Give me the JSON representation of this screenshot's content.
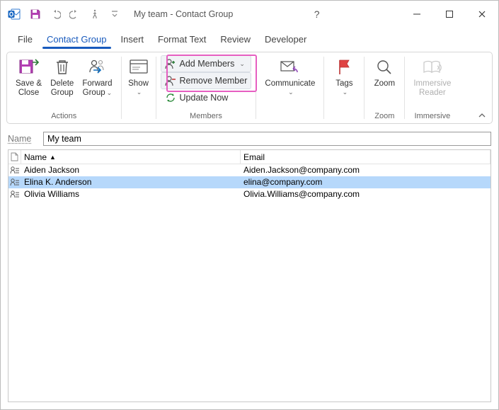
{
  "title": "My team  -  Contact Group",
  "tabs": {
    "file": "File",
    "contact_group": "Contact Group",
    "insert": "Insert",
    "format_text": "Format Text",
    "review": "Review",
    "developer": "Developer"
  },
  "ribbon": {
    "actions": {
      "save_close_l1": "Save &",
      "save_close_l2": "Close",
      "delete_l1": "Delete",
      "delete_l2": "Group",
      "forward_l1": "Forward",
      "forward_l2": "Group",
      "group_label": "Actions"
    },
    "show": {
      "btn": "Show",
      "group_label": ""
    },
    "members": {
      "add": "Add Members",
      "remove": "Remove Member",
      "update": "Update Now",
      "group_label": "Members"
    },
    "communicate": {
      "btn": "Communicate",
      "group_label": ""
    },
    "tags": {
      "btn": "Tags",
      "group_label": ""
    },
    "zoom": {
      "btn": "Zoom",
      "group_label": "Zoom"
    },
    "immersive": {
      "btn_l1": "Immersive",
      "btn_l2": "Reader",
      "group_label": "Immersive"
    }
  },
  "name_field": {
    "label": "Name",
    "value": "My team"
  },
  "grid": {
    "headers": {
      "name": "Name",
      "email": "Email"
    },
    "rows": [
      {
        "name": "Aiden Jackson",
        "email": "Aiden.Jackson@company.com",
        "selected": false
      },
      {
        "name": "Elina K. Anderson",
        "email": "elina@company.com",
        "selected": true
      },
      {
        "name": "Olivia Williams",
        "email": "Olivia.Williams@company.com",
        "selected": false
      }
    ]
  }
}
